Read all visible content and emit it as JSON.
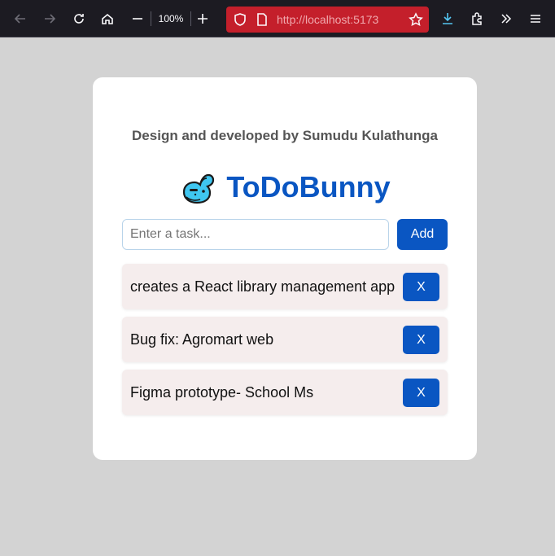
{
  "browser": {
    "zoom": "100%",
    "url_scheme": "http://",
    "url_host": "localhost",
    "url_port": ":5173",
    "icons": [
      "back-icon",
      "forward-icon",
      "reload-icon",
      "home-icon",
      "zoom-out-icon",
      "zoom-in-icon",
      "shield-icon",
      "page-icon",
      "bookmark-star-icon",
      "download-icon",
      "extensions-icon",
      "overflow-icon",
      "menu-icon"
    ]
  },
  "app": {
    "credit": "Design and developed by Sumudu Kulathunga",
    "title": "ToDoBunny",
    "input": {
      "placeholder": "Enter a task...",
      "value": ""
    },
    "add_label": "Add",
    "tasks": [
      {
        "text": "creates a React library management app",
        "delete_label": "X"
      },
      {
        "text": "Bug fix: Agromart web",
        "delete_label": "X"
      },
      {
        "text": "Figma prototype- School Ms",
        "delete_label": "X"
      }
    ],
    "colors": {
      "accent": "#0a56c2",
      "task_bg": "#f5eded",
      "page_bg": "#d3d3d3",
      "urlbar": "#c41f2b"
    }
  }
}
